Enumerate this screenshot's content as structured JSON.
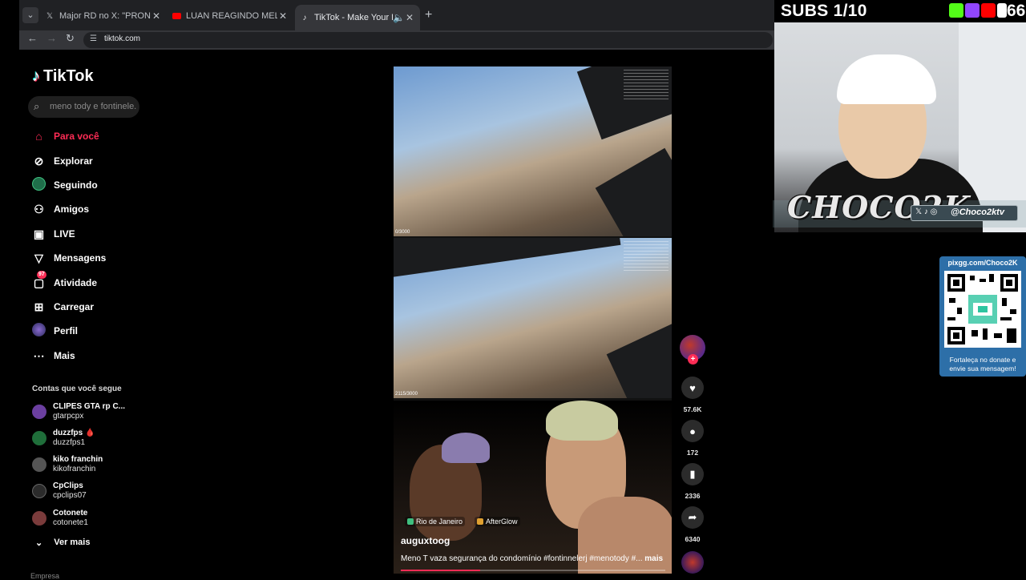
{
  "browser": {
    "tabs": [
      {
        "title": "Major RD no X: \"PRONUNCIAM",
        "favicon": "x-icon"
      },
      {
        "title": "LUAN REAGINDO MELHOR LÍD",
        "favicon": "youtube-icon"
      },
      {
        "title": "TikTok - Make Your Day",
        "favicon": "tiktok-icon",
        "active": true
      }
    ],
    "url": "tiktok.com"
  },
  "stream_overlay": {
    "subs_goal": "SUBS 1/10",
    "subs_count": "66",
    "logo_text": "CHOCO2K",
    "handle": "@Choco2ktv",
    "pix": {
      "url": "pixgg.com/Choco2K",
      "message": "Fortaleça no donate e envie sua mensagem!"
    }
  },
  "tiktok": {
    "logo": "TikTok",
    "search_placeholder": "meno tody e fontinele...",
    "menu": [
      {
        "label": "Para você",
        "icon": "home-icon",
        "active": true
      },
      {
        "label": "Explorar",
        "icon": "compass-icon"
      },
      {
        "label": "Seguindo",
        "icon": "following-avatar-icon"
      },
      {
        "label": "Amigos",
        "icon": "friends-icon"
      },
      {
        "label": "LIVE",
        "icon": "live-icon"
      },
      {
        "label": "Mensagens",
        "icon": "send-icon"
      },
      {
        "label": "Atividade",
        "icon": "activity-icon",
        "badge": "97"
      },
      {
        "label": "Carregar",
        "icon": "upload-icon"
      },
      {
        "label": "Perfil",
        "icon": "profile-avatar-icon"
      },
      {
        "label": "Mais",
        "icon": "more-icon"
      }
    ],
    "following_title": "Contas que você segue",
    "accounts": [
      {
        "name": "CLIPES GTA rp C...",
        "handle": "gtarpcpx",
        "color": "#6b3fa0"
      },
      {
        "name": "duzzfps",
        "handle": "duzzfps1",
        "color": "#1f6e3a",
        "emoji": "🩸"
      },
      {
        "name": "kiko franchin",
        "handle": "kikofranchin",
        "color": "#555555"
      },
      {
        "name": "CpClips",
        "handle": "cpclips07",
        "color": "#2b2b2b"
      },
      {
        "name": "Cotonete",
        "handle": "cotonete1",
        "color": "#7a3b3b"
      }
    ],
    "see_more": "Ver mais",
    "cut_label": "Empresa",
    "video": {
      "author": "auguxtoog",
      "caption": "Meno T vaza segurança do condomínio #fontinnelerj #menotody #...",
      "caption_more": "mais",
      "tags": [
        {
          "label": "Rio de Janeiro",
          "color": "#3fbf7f"
        },
        {
          "label": "AfterGlow",
          "color": "#e0a030"
        }
      ],
      "frame_counter_top": "0/3000",
      "frame_counter_bottom": "2115/3000",
      "progress": 0.3
    },
    "actions": {
      "likes": "57.6K",
      "comments": "172",
      "saves": "2336",
      "shares": "6340"
    }
  }
}
